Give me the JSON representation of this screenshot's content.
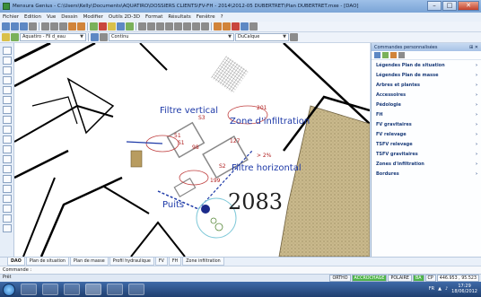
{
  "window": {
    "title": "Mensura Genius - C:\\Users\\Kelly\\Documents\\AQUATIRO\\DOSSIERS CLIENTS\\FV-FH - 2014\\2012-05 DUBERTRET\\Plan DUBERTRET.mxe - [DAO]",
    "min": "–",
    "max": "□",
    "close": "✕"
  },
  "menu": [
    "Fichier",
    "Edition",
    "Vue",
    "Dessin",
    "Modifier",
    "Outils 2D-3D",
    "Format",
    "Résultats",
    "Fenêtre",
    "?"
  ],
  "toolbar2": {
    "layer_combo": "Aquatiro - Fil d_eau",
    "linestyle_combo": "Continu",
    "layer_calque": "DuCalque"
  },
  "canvas": {
    "labels": {
      "filtre_vertical": "Filtre vertical",
      "zone_infiltration": "Zone d'infiltration",
      "filtre_horizontal": "Filtre horizontal",
      "puits": "Puits",
      "number": "2083",
      "s1": "S1",
      "s2": "S2",
      "s3": "S3",
      "v51": "51",
      "v98": "98",
      "v201": "201",
      "v127": "127",
      "v199": "199",
      "v2pct": "> 2%"
    }
  },
  "panel": {
    "title": "Commandes personnalisées",
    "pin": "⊞ ✕",
    "items": [
      {
        "label": "Légendes Plan de situation",
        "arrow": "›"
      },
      {
        "label": "Légendes Plan de masse",
        "arrow": "›"
      },
      {
        "label": "Arbres et plantes",
        "arrow": "›"
      },
      {
        "label": "Accessoires",
        "arrow": "›"
      },
      {
        "label": "Pédologie",
        "arrow": "›"
      },
      {
        "label": "FH",
        "arrow": "›"
      },
      {
        "label": "FV gravitaires",
        "arrow": "›"
      },
      {
        "label": "FV relevage",
        "arrow": "›"
      },
      {
        "label": "TSFV relevage",
        "arrow": "›"
      },
      {
        "label": "TSFV gravitaires",
        "arrow": "›"
      },
      {
        "label": "Zones d'infiltration",
        "arrow": "›"
      },
      {
        "label": "Bordures",
        "arrow": "›"
      }
    ]
  },
  "tabs": [
    "DAO",
    "Plan de situation",
    "Plan de masse",
    "Profil hydraulique",
    "FV",
    "FH",
    "Zone infiltration"
  ],
  "command_line": "Commande :",
  "status": {
    "left": "Prêt",
    "toggles": [
      "ORTHO",
      "ACCROCHAGE",
      "POLAIRE",
      "BA",
      "CP"
    ],
    "coords": "446.953 , 95.523"
  },
  "taskbar": {
    "lang": "FR",
    "time": "17:29",
    "date": "18/06/2012"
  }
}
